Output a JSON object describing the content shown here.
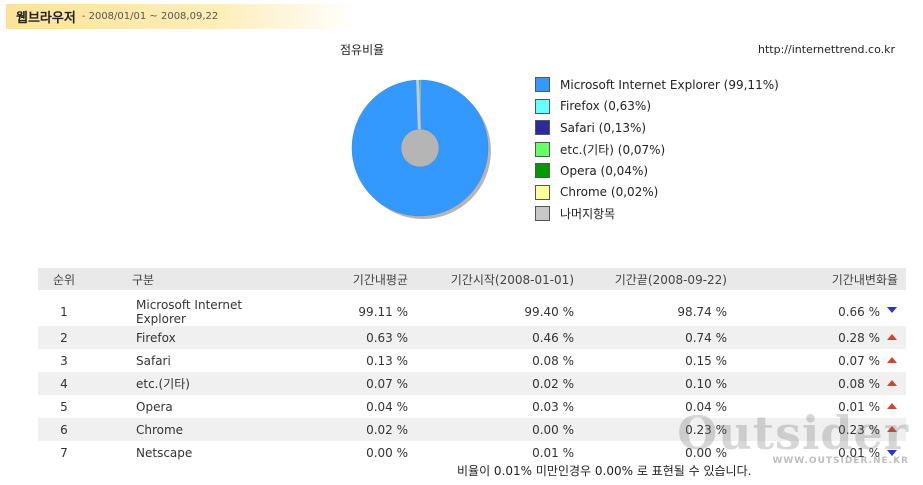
{
  "header": {
    "title": "웹브라우저",
    "date_range": "- 2008/01/01 ~ 2008,09,22"
  },
  "source_url": "http://internettrend.co.kr",
  "chart_data": [
    {
      "type": "pie",
      "title": "점유비율",
      "donut": true,
      "slices": [
        {
          "label": "Microsoft Internet Explorer (99,11%)",
          "value": 99.11,
          "color": "#3399ff"
        },
        {
          "label": "Firefox (0,63%)",
          "value": 0.63,
          "color": "#66ffff"
        },
        {
          "label": "Safari (0,13%)",
          "value": 0.13,
          "color": "#2b2b9e"
        },
        {
          "label": "etc.(기타) (0,07%)",
          "value": 0.07,
          "color": "#66ff66"
        },
        {
          "label": "Opera (0,04%)",
          "value": 0.04,
          "color": "#009900"
        },
        {
          "label": "Chrome (0,02%)",
          "value": 0.02,
          "color": "#ffff99"
        },
        {
          "label": "나머지항목",
          "value": 0,
          "color": "#c8c8c8"
        }
      ]
    },
    {
      "type": "table",
      "headers": {
        "rank": "순위",
        "name": "구분",
        "avg": "기간내평균",
        "start": "기간시작(2008-01-01)",
        "end": "기간끝(2008-09-22)",
        "change": "기간내변화율"
      },
      "rows": [
        {
          "rank": "1",
          "name": "Microsoft Internet Explorer",
          "avg": "99.11 %",
          "start": "99.40 %",
          "end": "98.74 %",
          "change": "0.66 %",
          "trend": "down"
        },
        {
          "rank": "2",
          "name": "Firefox",
          "avg": "0.63 %",
          "start": "0.46 %",
          "end": "0.74 %",
          "change": "0.28 %",
          "trend": "up"
        },
        {
          "rank": "3",
          "name": "Safari",
          "avg": "0.13 %",
          "start": "0.08 %",
          "end": "0.15 %",
          "change": "0.07 %",
          "trend": "up"
        },
        {
          "rank": "4",
          "name": "etc.(기타)",
          "avg": "0.07 %",
          "start": "0.02 %",
          "end": "0.10 %",
          "change": "0.08 %",
          "trend": "up"
        },
        {
          "rank": "5",
          "name": "Opera",
          "avg": "0.04 %",
          "start": "0.03 %",
          "end": "0.04 %",
          "change": "0.01 %",
          "trend": "up"
        },
        {
          "rank": "6",
          "name": "Chrome",
          "avg": "0.02 %",
          "start": "0.00 %",
          "end": "0.23 %",
          "change": "0.23 %",
          "trend": "up"
        },
        {
          "rank": "7",
          "name": "Netscape",
          "avg": "0.00 %",
          "start": "0.01 %",
          "end": "0.00 %",
          "change": "0.01 %",
          "trend": "down"
        }
      ],
      "trend_colors": {
        "up": "#d2452b",
        "down": "#2a35c9"
      }
    }
  ],
  "footnote": "비율이 0.01% 미만인경우 0.00% 로 표현될 수 있습니다.",
  "watermark": {
    "main": "Outsider",
    "url": "WWW.OUTSIDER.NE.KR"
  }
}
